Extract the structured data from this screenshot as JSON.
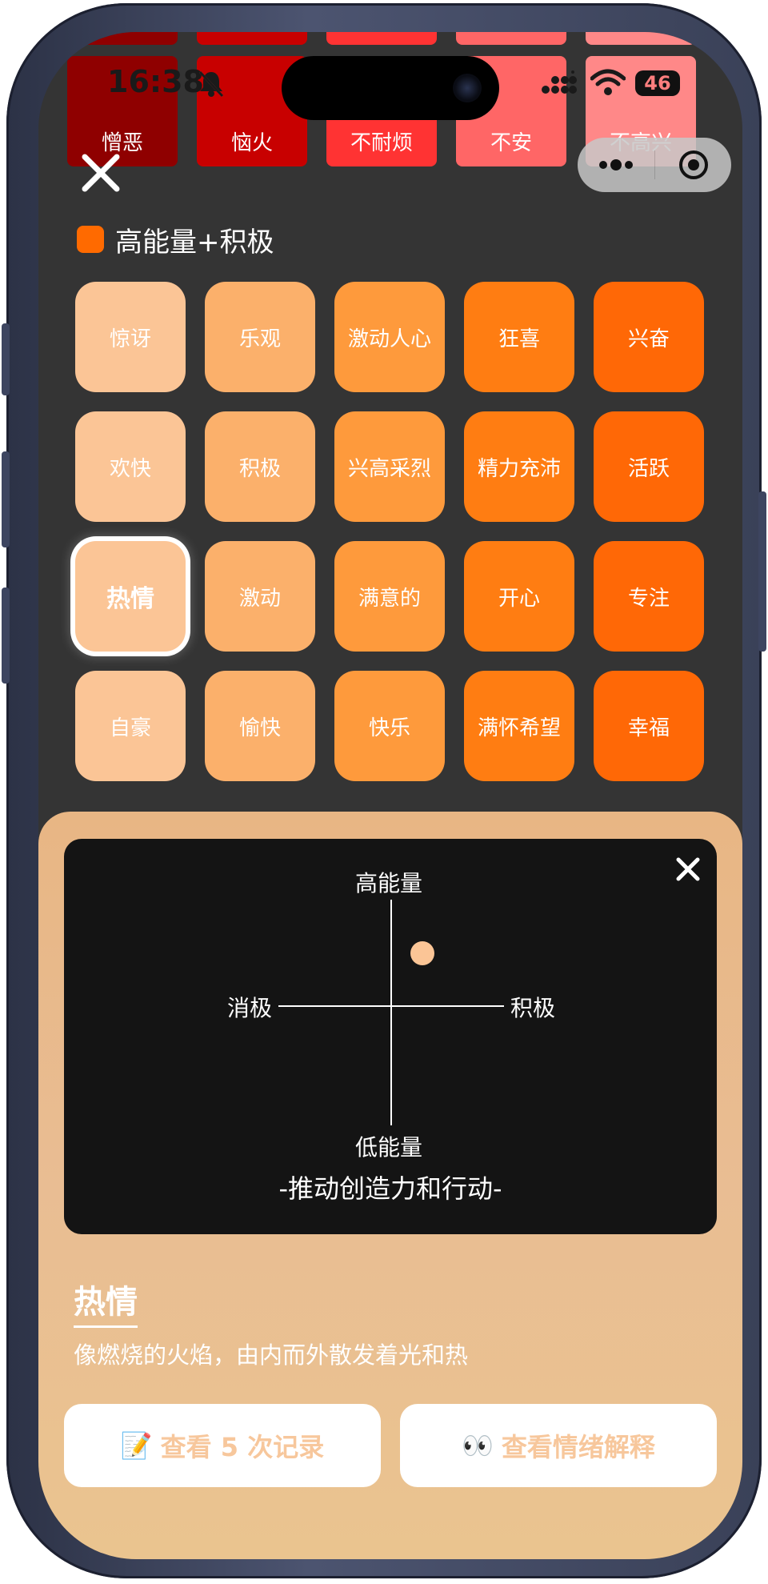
{
  "status_bar": {
    "time": "16:38",
    "battery": "46"
  },
  "top_row": {
    "tiles": [
      {
        "label": "憎恶",
        "color": "#8f0000"
      },
      {
        "label": "恼火",
        "color": "#c80000"
      },
      {
        "label": "不耐烦",
        "color": "#ff3333"
      },
      {
        "label": "不安",
        "color": "#ff6666"
      },
      {
        "label": "不高兴",
        "color": "#ff8888"
      }
    ]
  },
  "section": {
    "title": "高能量+积极",
    "color": "#ff6a00"
  },
  "grid": [
    [
      {
        "label": "惊讶",
        "color": "#fbc596"
      },
      {
        "label": "乐观",
        "color": "#fbb06b"
      },
      {
        "label": "激动人心",
        "color": "#fe9a3c"
      },
      {
        "label": "狂喜",
        "color": "#ff7d12"
      },
      {
        "label": "兴奋",
        "color": "#ff6806"
      }
    ],
    [
      {
        "label": "欢快",
        "color": "#fbc596"
      },
      {
        "label": "积极",
        "color": "#fbb06b"
      },
      {
        "label": "兴高采烈",
        "color": "#fe9a3c"
      },
      {
        "label": "精力充沛",
        "color": "#ff7d12"
      },
      {
        "label": "活跃",
        "color": "#ff6806"
      }
    ],
    [
      {
        "label": "热情",
        "color": "#fbc596"
      },
      {
        "label": "激动",
        "color": "#fbb06b"
      },
      {
        "label": "满意的",
        "color": "#fe9a3c"
      },
      {
        "label": "开心",
        "color": "#ff7d12"
      },
      {
        "label": "专注",
        "color": "#ff6806"
      }
    ],
    [
      {
        "label": "自豪",
        "color": "#fbc596"
      },
      {
        "label": "愉快",
        "color": "#fbb06b"
      },
      {
        "label": "快乐",
        "color": "#fe9a3c"
      },
      {
        "label": "满怀希望",
        "color": "#ff7d12"
      },
      {
        "label": "幸福",
        "color": "#ff6806"
      }
    ]
  ],
  "selected": {
    "row": 2,
    "col": 0
  },
  "quadrant": {
    "top": "高能量",
    "bottom": "低能量",
    "left": "消极",
    "right": "积极",
    "subtitle": "-推动创造力和行动-",
    "point": {
      "positivity": 0.28,
      "energy": 0.47
    },
    "point_color": "#fbc596"
  },
  "detail": {
    "name": "热情",
    "description": "像燃烧的火焰，由内而外散发着光和热"
  },
  "buttons": {
    "records_icon": "📝",
    "records_label": "查看 5 次记录",
    "explain_icon": "👀",
    "explain_label": "查看情绪解释"
  }
}
